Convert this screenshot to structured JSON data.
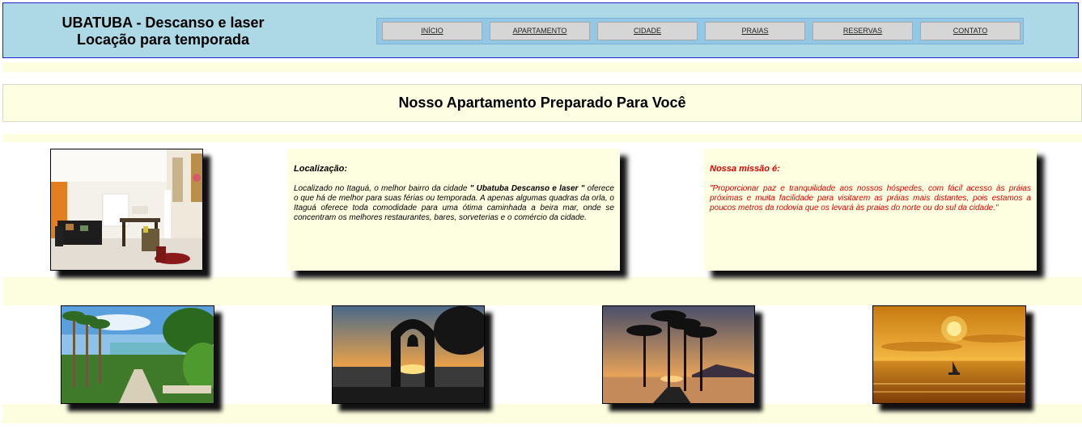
{
  "header": {
    "brand_line1": "UBATUBA - Descanso e laser",
    "brand_line2": "Locação para temporada"
  },
  "nav": {
    "items": [
      {
        "label": "INÍCIO"
      },
      {
        "label": "APARTAMENTO"
      },
      {
        "label": "CIDADE"
      },
      {
        "label": "PRAIAS"
      },
      {
        "label": "RESERVAS"
      },
      {
        "label": "CONTATO"
      }
    ]
  },
  "page_title": "Nosso Apartamento Preparado Para Você",
  "location_card": {
    "heading": "Localização:",
    "text_before": "Localizado no Itaguá, o melhor bairro da cidade ",
    "text_bold": "\" Ubatuba Descanso e laser \"",
    "text_after": " oferece o que há de melhor para suas férias ou temporada. A apenas algumas quadras da orla, o Itaguá oferece toda comodidade para uma ótima caminhada a beira mar, onde se concentram os melhores restaurantes, bares, sorveterias e o comércio da cidade."
  },
  "mission_card": {
    "heading": "Nossa missão é:",
    "text": "\"Proporcionar paz e tranquilidade aos nossos hóspedes, com fácil acesso às práias próximas e muita facilidade para visitarem as práias mais distantes, pois estamos a poucos metros da rodovia que os levará às praias do norte ou do sul da cidade.\"",
    "color": "#dd0000"
  },
  "colors": {
    "header_bg": "#add8e6",
    "band": "#fdfde0",
    "card_bg": "#fefee0"
  }
}
